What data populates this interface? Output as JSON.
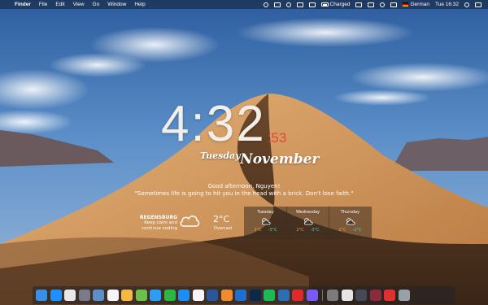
{
  "menubar": {
    "apple_glyph": "",
    "app_name": "Finder",
    "menus": [
      "File",
      "Edit",
      "View",
      "Go",
      "Window",
      "Help"
    ],
    "battery_status": "Charged",
    "input_language": "German",
    "clock": "Tue 16:32"
  },
  "widget": {
    "time_hm": "4:32",
    "time_sec": ":53",
    "day": "Tuesday",
    "month": "November",
    "greeting": "Good afternoon, Nguyen!",
    "quote": "\"Sometimes life is going to hit you in the head with a brick. Don't lose faith.\"",
    "colors": {
      "seconds": "#e4453c",
      "high_temp": "#f0a040",
      "low_temp": "#4fd1c5"
    }
  },
  "weather": {
    "city": "REGENSBURG",
    "message_line1": "Keep calm and",
    "message_line2": "continue coding",
    "current_icon": "cloud-icon",
    "temperature": "2°C",
    "condition": "Overcast",
    "forecast": [
      {
        "day": "Tuesday",
        "icon": "partly-cloudy-icon",
        "high": "3°C",
        "low": "-3°C"
      },
      {
        "day": "Wednesday",
        "icon": "partly-cloudy-icon",
        "high": "2°C",
        "low": "-3°C"
      },
      {
        "day": "Thursday",
        "icon": "partly-cloudy-icon",
        "high": "2°C",
        "low": "-2°C"
      }
    ]
  },
  "dock": {
    "apps": [
      {
        "name": "finder",
        "color": "#3a8ee6"
      },
      {
        "name": "safari",
        "color": "#1e90ff"
      },
      {
        "name": "chrome",
        "color": "#e8e8e8"
      },
      {
        "name": "launchpad",
        "color": "#7a7a8a"
      },
      {
        "name": "preview",
        "color": "#5b8fc9"
      },
      {
        "name": "calendar",
        "color": "#f5f5f5"
      },
      {
        "name": "photos",
        "color": "#f4b942"
      },
      {
        "name": "maps",
        "color": "#6cc04a"
      },
      {
        "name": "messages",
        "color": "#2d9cf2"
      },
      {
        "name": "whatsapp",
        "color": "#2bb741"
      },
      {
        "name": "app-store",
        "color": "#1c8df2"
      },
      {
        "name": "itunes",
        "color": "#f5f5f5"
      },
      {
        "name": "word",
        "color": "#2b579a"
      },
      {
        "name": "books",
        "color": "#f08c2e"
      },
      {
        "name": "xcode",
        "color": "#1f6fd1"
      },
      {
        "name": "photoshop",
        "color": "#0b2a4a"
      },
      {
        "name": "spotify",
        "color": "#1db954"
      },
      {
        "name": "code-editor",
        "color": "#2c6db5"
      },
      {
        "name": "presenter",
        "color": "#e02a2a"
      },
      {
        "name": "messenger",
        "color": "#7a5af5"
      }
    ],
    "extras": [
      {
        "name": "system-preferences",
        "color": "#7b7b7b"
      },
      {
        "name": "keynote",
        "color": "#e5e5e5"
      },
      {
        "name": "screen-monitor",
        "color": "#444a56"
      },
      {
        "name": "rebel-app",
        "color": "#8a2a3a"
      },
      {
        "name": "record-app",
        "color": "#e03030"
      },
      {
        "name": "trash",
        "color": "#9aa0a8"
      }
    ]
  }
}
